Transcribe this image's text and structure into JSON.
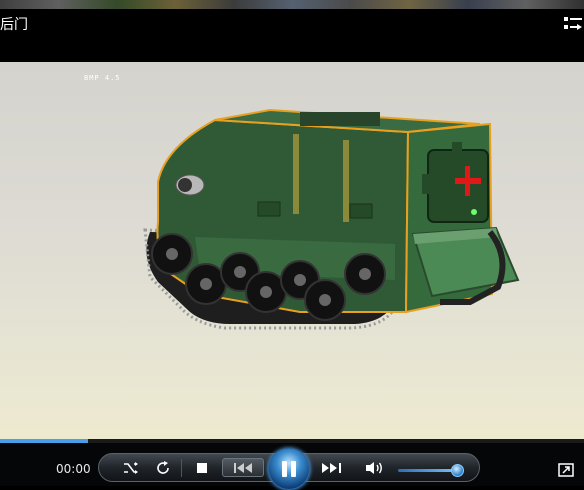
{
  "window": {
    "title": "后门"
  },
  "video": {
    "hud_text": "BMP 4.5",
    "scene": "green tracked vehicle with red cross ambulance marking",
    "seek_progress": 0.15
  },
  "controls": {
    "time": "00:00",
    "volume_level": 0.95,
    "icons": [
      "shuffle-icon",
      "repeat-icon",
      "stop-icon",
      "previous-icon",
      "pause-icon",
      "next-icon",
      "volume-icon",
      "fullscreen-icon",
      "playlist-icon"
    ]
  },
  "colors": {
    "accent": "#3c8ed0",
    "vehicle": "#2f5a35",
    "trim": "#e8a020",
    "cross": "#e01818"
  }
}
